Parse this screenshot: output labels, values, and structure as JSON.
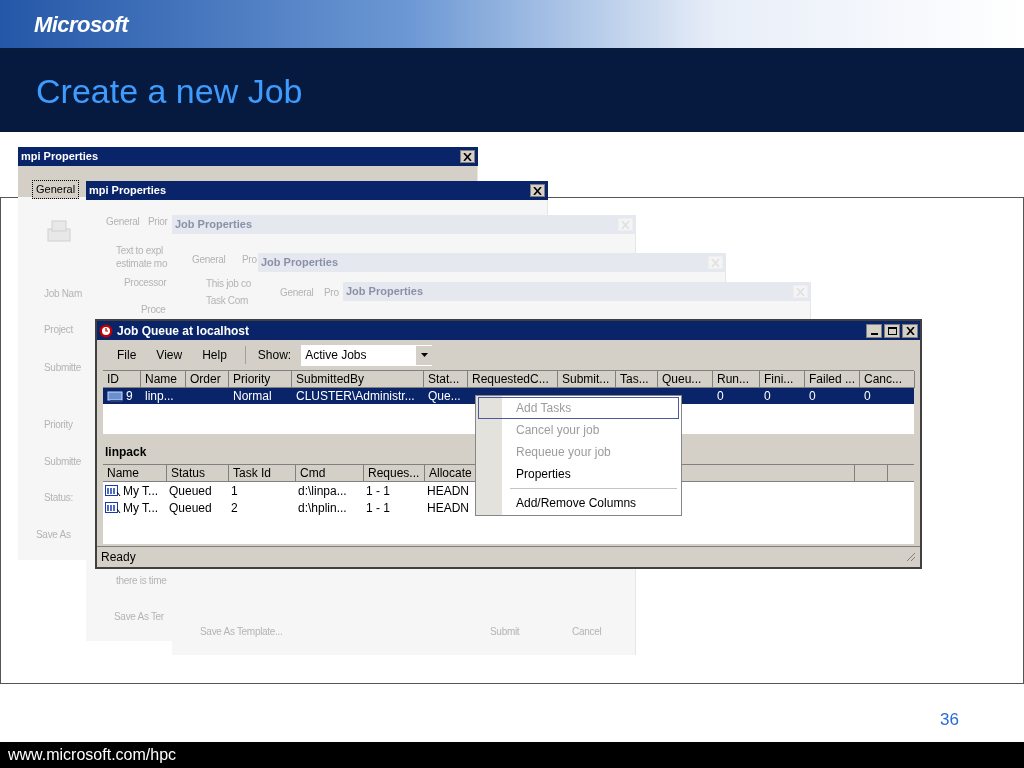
{
  "header": {
    "logo": "Microsoft",
    "title": "Create a new Job"
  },
  "background_windows": [
    {
      "title": "mpi Properties",
      "tab": "General",
      "labels": [
        "Job Nam",
        "Project",
        "Submitte",
        "Priority",
        "Submitte",
        "Status:",
        "Save As"
      ]
    },
    {
      "title": "mpi Properties",
      "labels": [
        "General",
        "Prior",
        "Text to expl",
        "estimate mo",
        "Processor",
        "Proce",
        "there is time",
        "Save As Ter"
      ]
    },
    {
      "title": "Job Properties",
      "labels": [
        "General",
        "Pro",
        "This job co",
        "Task Com",
        "Save As Template...",
        "Submit",
        "Cancel"
      ]
    },
    {
      "title": "Job Properties",
      "labels": [
        "General",
        "Pro"
      ]
    },
    {
      "title": "Job Properties"
    }
  ],
  "job_queue": {
    "title": "Job Queue at localhost",
    "menu": [
      "File",
      "View",
      "Help"
    ],
    "show_label": "Show:",
    "show_value": "Active Jobs",
    "job_columns": [
      "ID",
      "Name",
      "Order",
      "Priority",
      "SubmittedBy",
      "Stat...",
      "RequestedC...",
      "Submit...",
      "Tas...",
      "Queu...",
      "Run...",
      "Fini...",
      "Failed ...",
      "Canc..."
    ],
    "job_rows": [
      {
        "selected": true,
        "id": "9",
        "name": "linp...",
        "priority": "Normal",
        "submitted_by": "CLUSTER\\Administr...",
        "status": "Que...",
        "running": "0",
        "finished": "0",
        "failed": "0",
        "canceled": "0"
      }
    ],
    "job_name": "linpack",
    "task_columns": [
      "Name",
      "Status",
      "Task Id",
      "Cmd",
      "Reques...",
      "Allocate"
    ],
    "task_rows": [
      {
        "cells": [
          "My T...",
          "Queued",
          "1",
          "d:\\linpa...",
          "1 - 1",
          "HEADN"
        ]
      },
      {
        "cells": [
          "My T...",
          "Queued",
          "2",
          "d:\\hplin...",
          "1 - 1",
          "HEADN"
        ]
      }
    ],
    "status": "Ready"
  },
  "context_menu": [
    {
      "kind": "item",
      "label": "Add Tasks",
      "disabled": true,
      "selected": true
    },
    {
      "kind": "item",
      "label": "Cancel your job",
      "disabled": true,
      "selected": false
    },
    {
      "kind": "item",
      "label": "Requeue your job",
      "disabled": true,
      "selected": false
    },
    {
      "kind": "item",
      "label": "Properties",
      "disabled": false,
      "selected": false
    },
    {
      "kind": "separator"
    },
    {
      "kind": "item",
      "label": "Add/Remove Columns",
      "disabled": false,
      "selected": false
    }
  ],
  "slide_number": "36",
  "footer": "www.microsoft.com/hpc"
}
